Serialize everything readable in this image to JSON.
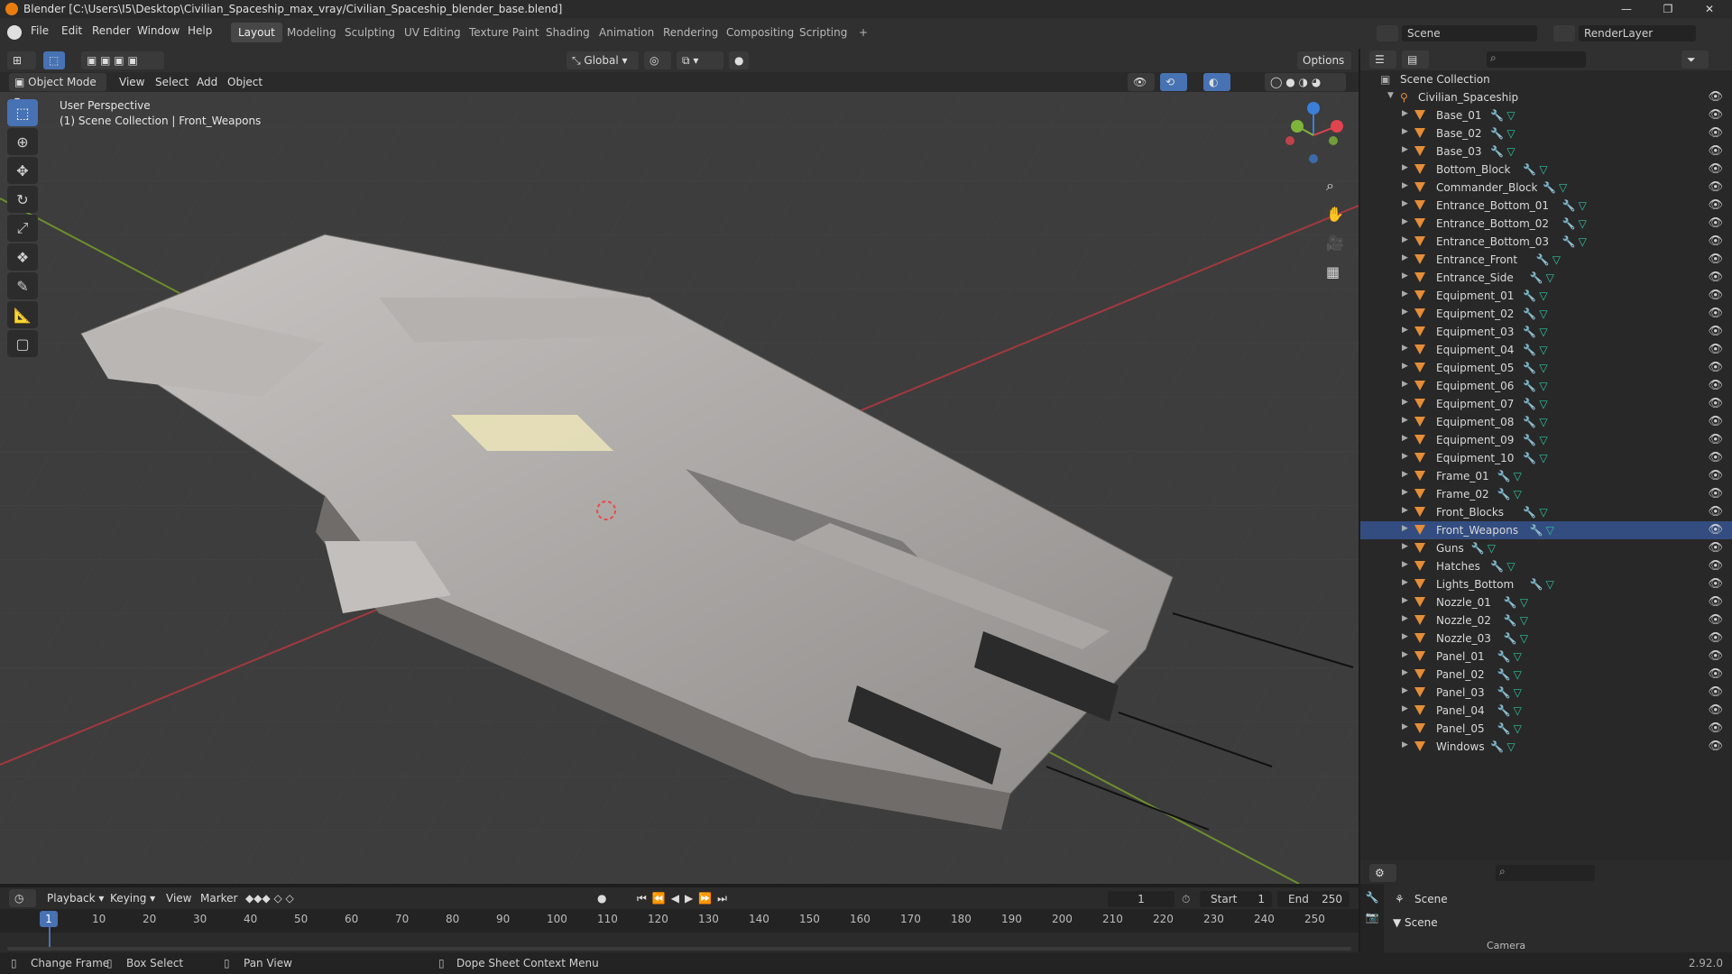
{
  "window": {
    "title": "Blender [C:\\Users\\I5\\Desktop\\Civilian_Spaceship_max_vray/Civilian_Spaceship_blender_base.blend]",
    "min": "—",
    "max": "❐",
    "close": "✕"
  },
  "menu": [
    "File",
    "Edit",
    "Render",
    "Window",
    "Help"
  ],
  "workspaces": [
    "Layout",
    "Modeling",
    "Sculpting",
    "UV Editing",
    "Texture Paint",
    "Shading",
    "Animation",
    "Rendering",
    "Compositing",
    "Scripting",
    "+"
  ],
  "scene_field": "Scene",
  "renderlayer_field": "RenderLayer",
  "header": {
    "mode": "Object Mode",
    "view": "View",
    "select": "Select",
    "add": "Add",
    "object": "Object",
    "transform_orientation": "Global",
    "options": "Options"
  },
  "viewport": {
    "perspective": "User Perspective",
    "collection": "(1) Scene Collection | Front_Weapons"
  },
  "outliner": {
    "root": "Scene Collection",
    "collection": "Civilian_Spaceship",
    "objects": [
      "Base_01",
      "Base_02",
      "Base_03",
      "Bottom_Block",
      "Commander_Block",
      "Entrance_Bottom_01",
      "Entrance_Bottom_02",
      "Entrance_Bottom_03",
      "Entrance_Front",
      "Entrance_Side",
      "Equipment_01",
      "Equipment_02",
      "Equipment_03",
      "Equipment_04",
      "Equipment_05",
      "Equipment_06",
      "Equipment_07",
      "Equipment_08",
      "Equipment_09",
      "Equipment_10",
      "Frame_01",
      "Frame_02",
      "Front_Blocks",
      "Front_Weapons",
      "Guns",
      "Hatches",
      "Lights_Bottom",
      "Nozzle_01",
      "Nozzle_02",
      "Nozzle_03",
      "Panel_01",
      "Panel_02",
      "Panel_03",
      "Panel_04",
      "Panel_05",
      "Windows"
    ],
    "selected": "Front_Weapons"
  },
  "properties": {
    "title": "Scene",
    "section": "Scene",
    "camera_label": "Camera"
  },
  "timeline": {
    "playback": "Playback",
    "keying": "Keying",
    "view": "View",
    "marker": "Marker",
    "current_frame": "1",
    "start_label": "Start",
    "start": "1",
    "end_label": "End",
    "end": "250",
    "ticks": [
      "10",
      "20",
      "30",
      "40",
      "50",
      "60",
      "70",
      "80",
      "90",
      "100",
      "110",
      "120",
      "130",
      "140",
      "150",
      "160",
      "170",
      "180",
      "190",
      "200",
      "210",
      "220",
      "230",
      "240",
      "250"
    ]
  },
  "statusbar": {
    "change_frame": "Change Frame",
    "box_select": "Box Select",
    "pan_view": "Pan View",
    "context_menu": "Dope Sheet Context Menu",
    "version": "2.92.0"
  },
  "colors": {
    "accent": "#4772b3",
    "x_axis": "#e0444e",
    "y_axis": "#7fb43a",
    "z_axis": "#3b7fd8",
    "object_icon": "#e58d37"
  }
}
